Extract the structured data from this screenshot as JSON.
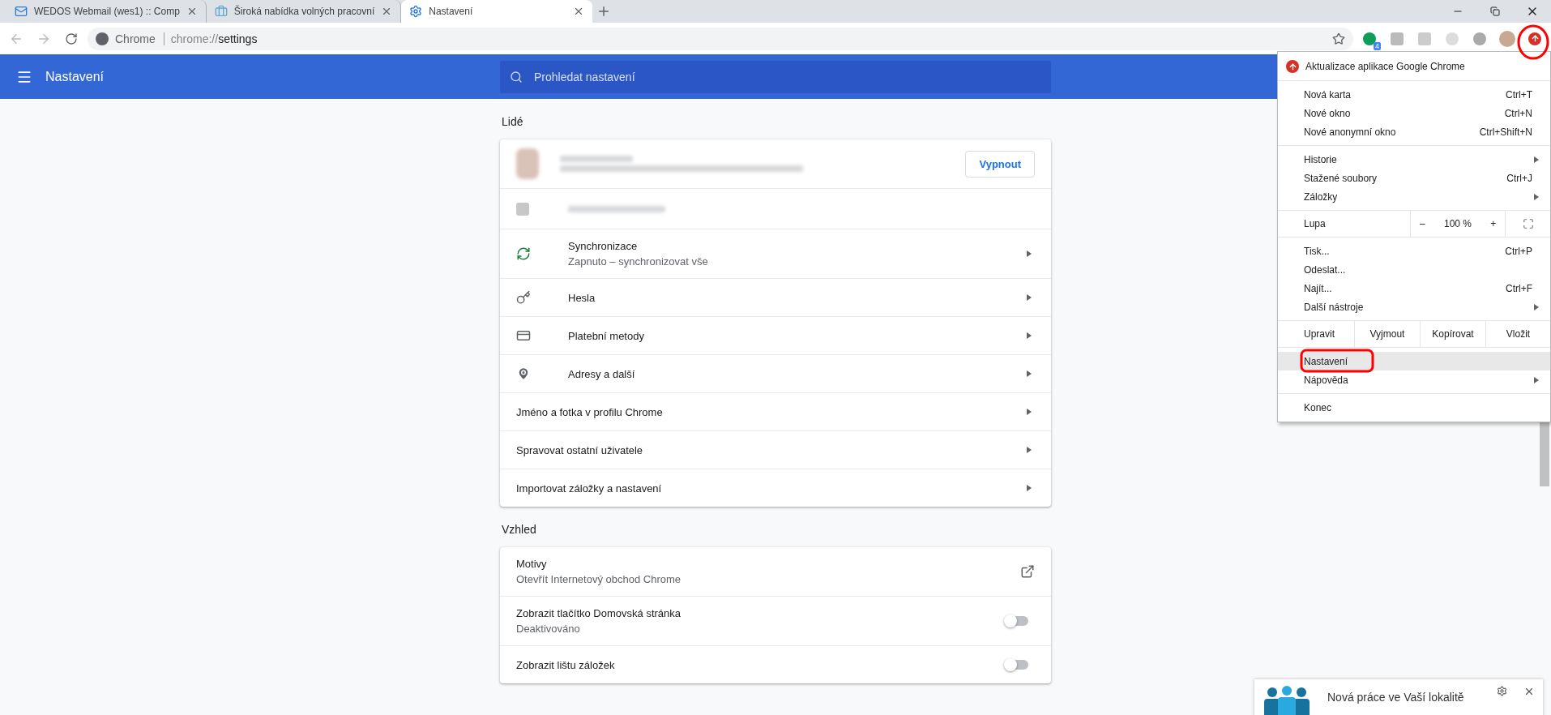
{
  "tabs": [
    {
      "title": "WEDOS Webmail (wes1) :: Comp",
      "selected": false
    },
    {
      "title": "Široká nabídka volných pracovní",
      "selected": false
    },
    {
      "title": "Nastavení",
      "selected": true
    }
  ],
  "address": {
    "chip": "Chrome",
    "scheme": "chrome://",
    "path": "settings"
  },
  "extension_badge": "4",
  "header": {
    "title": "Nastavení",
    "search_placeholder": "Prohledat nastavení"
  },
  "sections": [
    {
      "heading": "Lidé",
      "profile": {
        "button": "Vypnout"
      },
      "rows": [
        {
          "kind": "sync",
          "title": "Synchronizace",
          "subtitle": "Zapnuto – synchronizovat vše"
        },
        {
          "kind": "passwords",
          "title": "Hesla"
        },
        {
          "kind": "payments",
          "title": "Platební metody"
        },
        {
          "kind": "addresses",
          "title": "Adresy a další"
        },
        {
          "kind": "link",
          "title": "Jméno a fotka v profilu Chrome"
        },
        {
          "kind": "link",
          "title": "Spravovat ostatní uživatele"
        },
        {
          "kind": "link",
          "title": "Importovat záložky a nastavení"
        }
      ]
    },
    {
      "heading": "Vzhled",
      "rows": [
        {
          "kind": "external",
          "title": "Motivy",
          "subtitle": "Otevřít Internetový obchod Chrome"
        },
        {
          "kind": "toggle",
          "title": "Zobrazit tlačítko Domovská stránka",
          "subtitle": "Deaktivováno",
          "on": false
        },
        {
          "kind": "toggle",
          "title": "Zobrazit lištu záložek",
          "on": false
        }
      ]
    }
  ],
  "menu": {
    "items": [
      {
        "kind": "update",
        "label": "Aktualizace aplikace Google Chrome"
      },
      {
        "kind": "separator"
      },
      {
        "kind": "item",
        "label": "Nová karta",
        "shortcut": "Ctrl+T",
        "submenu": false,
        "selected": false
      },
      {
        "kind": "item",
        "label": "Nové okno",
        "shortcut": "Ctrl+N",
        "submenu": false,
        "selected": false
      },
      {
        "kind": "item",
        "label": "Nové anonymní okno",
        "shortcut": "Ctrl+Shift+N",
        "submenu": false,
        "selected": false
      },
      {
        "kind": "separator"
      },
      {
        "kind": "item",
        "label": "Historie",
        "submenu": true,
        "selected": false
      },
      {
        "kind": "item",
        "label": "Stažené soubory",
        "shortcut": "Ctrl+J",
        "submenu": false,
        "selected": false
      },
      {
        "kind": "item",
        "label": "Záložky",
        "submenu": true,
        "selected": false
      },
      {
        "kind": "separator"
      },
      {
        "kind": "zoom",
        "label": "Lupa",
        "minus": "–",
        "value": "100 %",
        "plus": "+"
      },
      {
        "kind": "separator"
      },
      {
        "kind": "item",
        "label": "Tisk...",
        "shortcut": "Ctrl+P",
        "submenu": false,
        "selected": false
      },
      {
        "kind": "item",
        "label": "Odeslat...",
        "submenu": false,
        "selected": false
      },
      {
        "kind": "item",
        "label": "Najít...",
        "shortcut": "Ctrl+F",
        "submenu": false,
        "selected": false
      },
      {
        "kind": "item",
        "label": "Další nástroje",
        "submenu": true,
        "selected": false
      },
      {
        "kind": "separator"
      },
      {
        "kind": "edit",
        "label": "Upravit",
        "actions": [
          "Vyjmout",
          "Kopírovat",
          "Vložit"
        ]
      },
      {
        "kind": "separator"
      },
      {
        "kind": "item",
        "label": "Nastavení",
        "submenu": false,
        "selected": true
      },
      {
        "kind": "item",
        "label": "Nápověda",
        "submenu": true,
        "selected": false
      },
      {
        "kind": "separator"
      },
      {
        "kind": "item",
        "label": "Konec",
        "submenu": false,
        "selected": false
      }
    ]
  },
  "notification": {
    "title": "Nová práce ve Vaší lokalitě"
  }
}
